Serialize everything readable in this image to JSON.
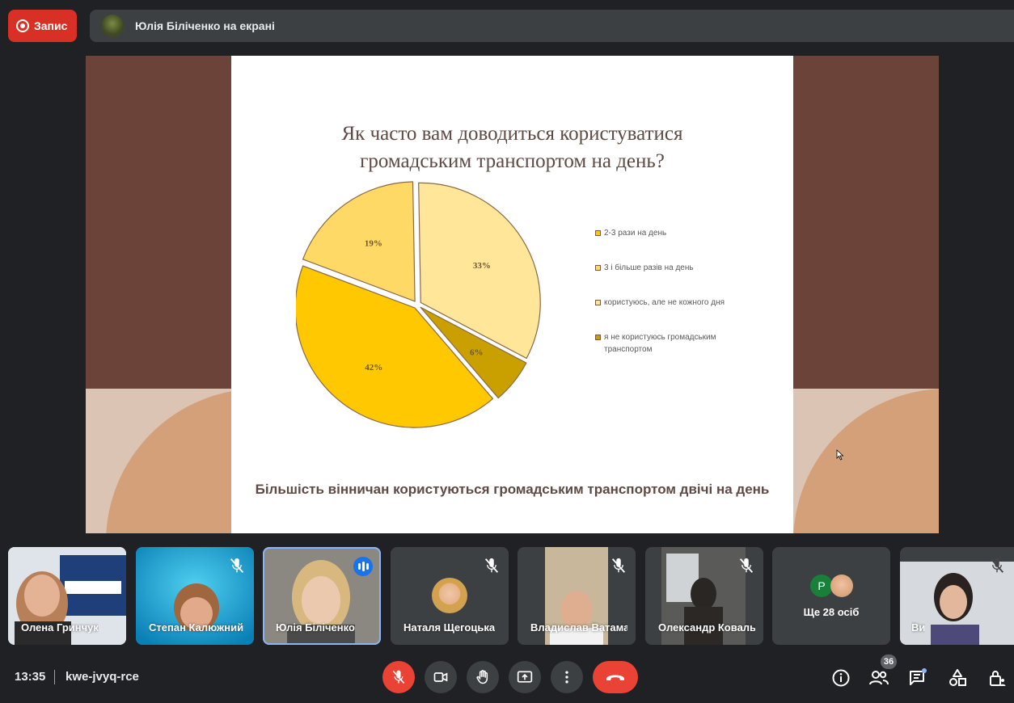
{
  "recording": {
    "label": "Запис"
  },
  "presenter": {
    "label": "Юлія Біліченко на екрані"
  },
  "slide": {
    "title": "Як часто вам доводиться користуватися\nгромадським транспортом на день?",
    "footer": "Більшість вінничан користуються громадським транспортом двічі на день"
  },
  "chart_data": {
    "type": "pie",
    "title": "Як часто вам доводиться користуватися громадським транспортом на день?",
    "categories": [
      "2-3 рази на день",
      "3 і більше разів на день",
      "користуюсь, але не кожного дня",
      "я не користуюсь громадським транспортом"
    ],
    "values": [
      42,
      19,
      33,
      6
    ],
    "labels": [
      "42%",
      "19%",
      "33%",
      "6%"
    ],
    "colors": [
      "#ffc800",
      "#ffd966",
      "#ffe699",
      "#c9a000"
    ],
    "legend_placement": "right"
  },
  "participants": [
    {
      "name": "Олена Гринчук"
    },
    {
      "name": "Степан Калюжний"
    },
    {
      "name": "Юлія Біліченко"
    },
    {
      "name": "Наталя Щегоцька"
    },
    {
      "name": "Владислав Ватаманюк"
    },
    {
      "name": "Олександр Ковальчук"
    },
    {
      "name": "Ще 28 осіб",
      "avatar_letter": "P"
    },
    {
      "name": "Ви"
    }
  ],
  "bottom": {
    "time": "13:35",
    "meeting_code": "kwe-jvyq-rce",
    "people_count": "36"
  },
  "theme": {
    "danger": "#ea4335",
    "accent": "#8ab4f8",
    "bar": "#3c4043",
    "bg": "#202124"
  }
}
